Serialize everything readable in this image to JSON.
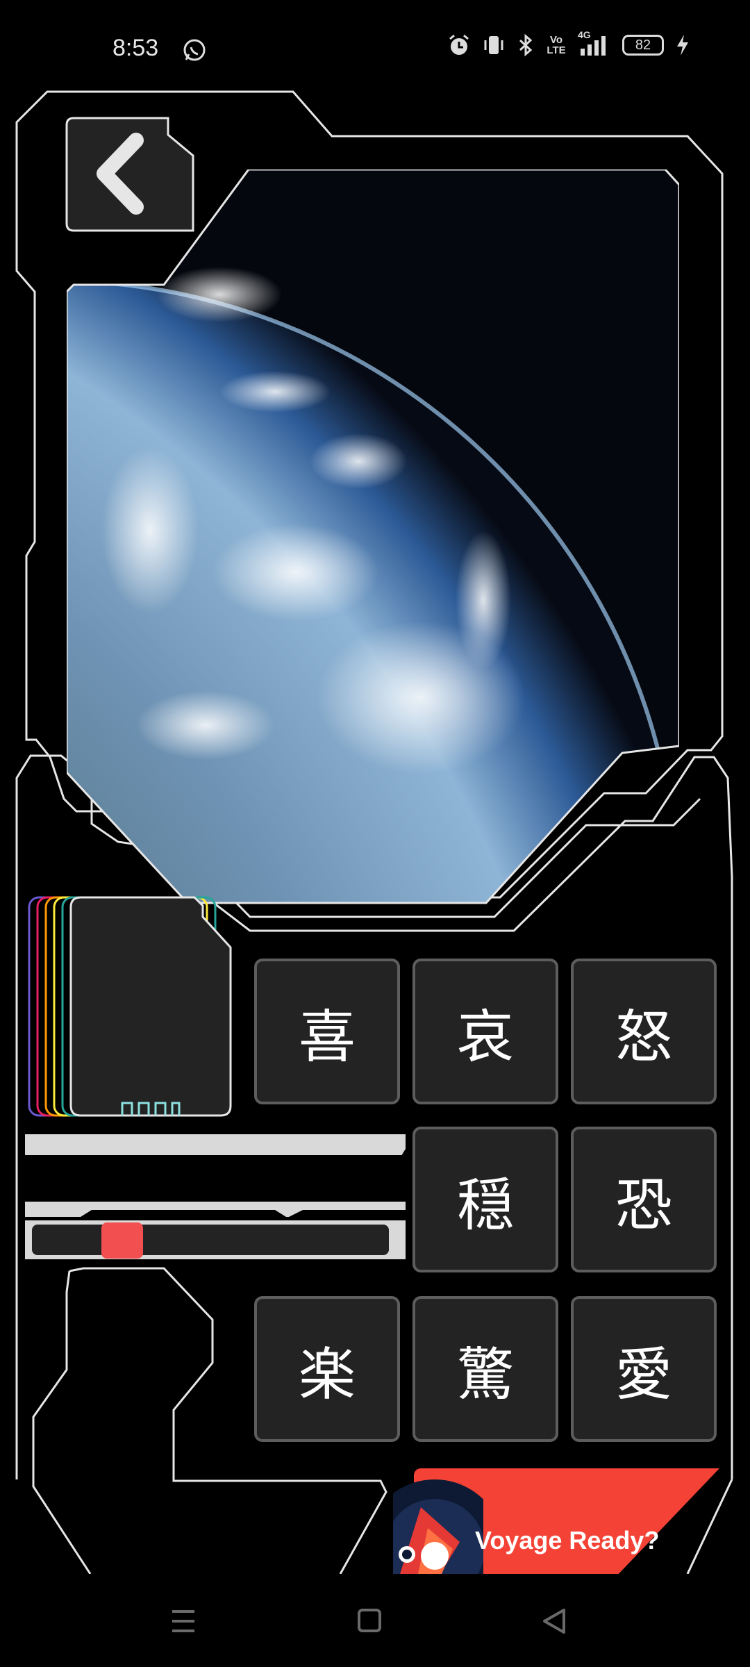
{
  "status_bar": {
    "time": "8:53",
    "battery": "82",
    "icons": [
      "whatsapp-icon",
      "alarm-icon",
      "vibrate-icon",
      "bluetooth-icon",
      "volte-icon",
      "signal-4g-icon",
      "battery-icon",
      "charging-icon"
    ],
    "volte": "Vo LTE",
    "net": "4G"
  },
  "emotions": {
    "joy": "喜",
    "sorrow": "哀",
    "anger": "怒",
    "calm": "穏",
    "fear": "恐",
    "fun": "楽",
    "surprise": "驚",
    "love": "愛"
  },
  "voyage": {
    "label": "Voyage Ready?"
  },
  "colors": {
    "accent_red": "#f44336",
    "slider_thumb": "#f25050",
    "button_bg": "#232323",
    "outline": "#e6e6e6"
  },
  "slider": {
    "value": 0.25
  }
}
